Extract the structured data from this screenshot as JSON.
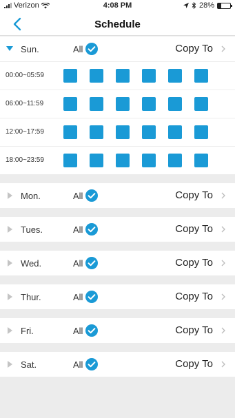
{
  "status_bar": {
    "carrier": "Verizon",
    "time": "4:08 PM",
    "battery_percent": "28%",
    "battery_level": 0.28
  },
  "nav": {
    "title": "Schedule",
    "back_icon": "chevron-left-icon"
  },
  "colors": {
    "accent": "#1a9ad6",
    "background": "#ececec",
    "row": "#ffffff"
  },
  "all_label": "All",
  "copy_to_label": "Copy To",
  "expanded_day": {
    "label": "Sun.",
    "all_checked": true,
    "slots": [
      {
        "time": "00:00~05:59",
        "blocks": [
          true,
          true,
          true,
          true,
          true,
          true
        ]
      },
      {
        "time": "06:00~11:59",
        "blocks": [
          true,
          true,
          true,
          true,
          true,
          true
        ]
      },
      {
        "time": "12:00~17:59",
        "blocks": [
          true,
          true,
          true,
          true,
          true,
          true
        ]
      },
      {
        "time": "18:00~23:59",
        "blocks": [
          true,
          true,
          true,
          true,
          true,
          true
        ]
      }
    ]
  },
  "collapsed_days": [
    {
      "label": "Mon.",
      "all_checked": true
    },
    {
      "label": "Tues.",
      "all_checked": true
    },
    {
      "label": "Wed.",
      "all_checked": true
    },
    {
      "label": "Thur.",
      "all_checked": true
    },
    {
      "label": "Fri.",
      "all_checked": true
    },
    {
      "label": "Sat.",
      "all_checked": true
    }
  ]
}
